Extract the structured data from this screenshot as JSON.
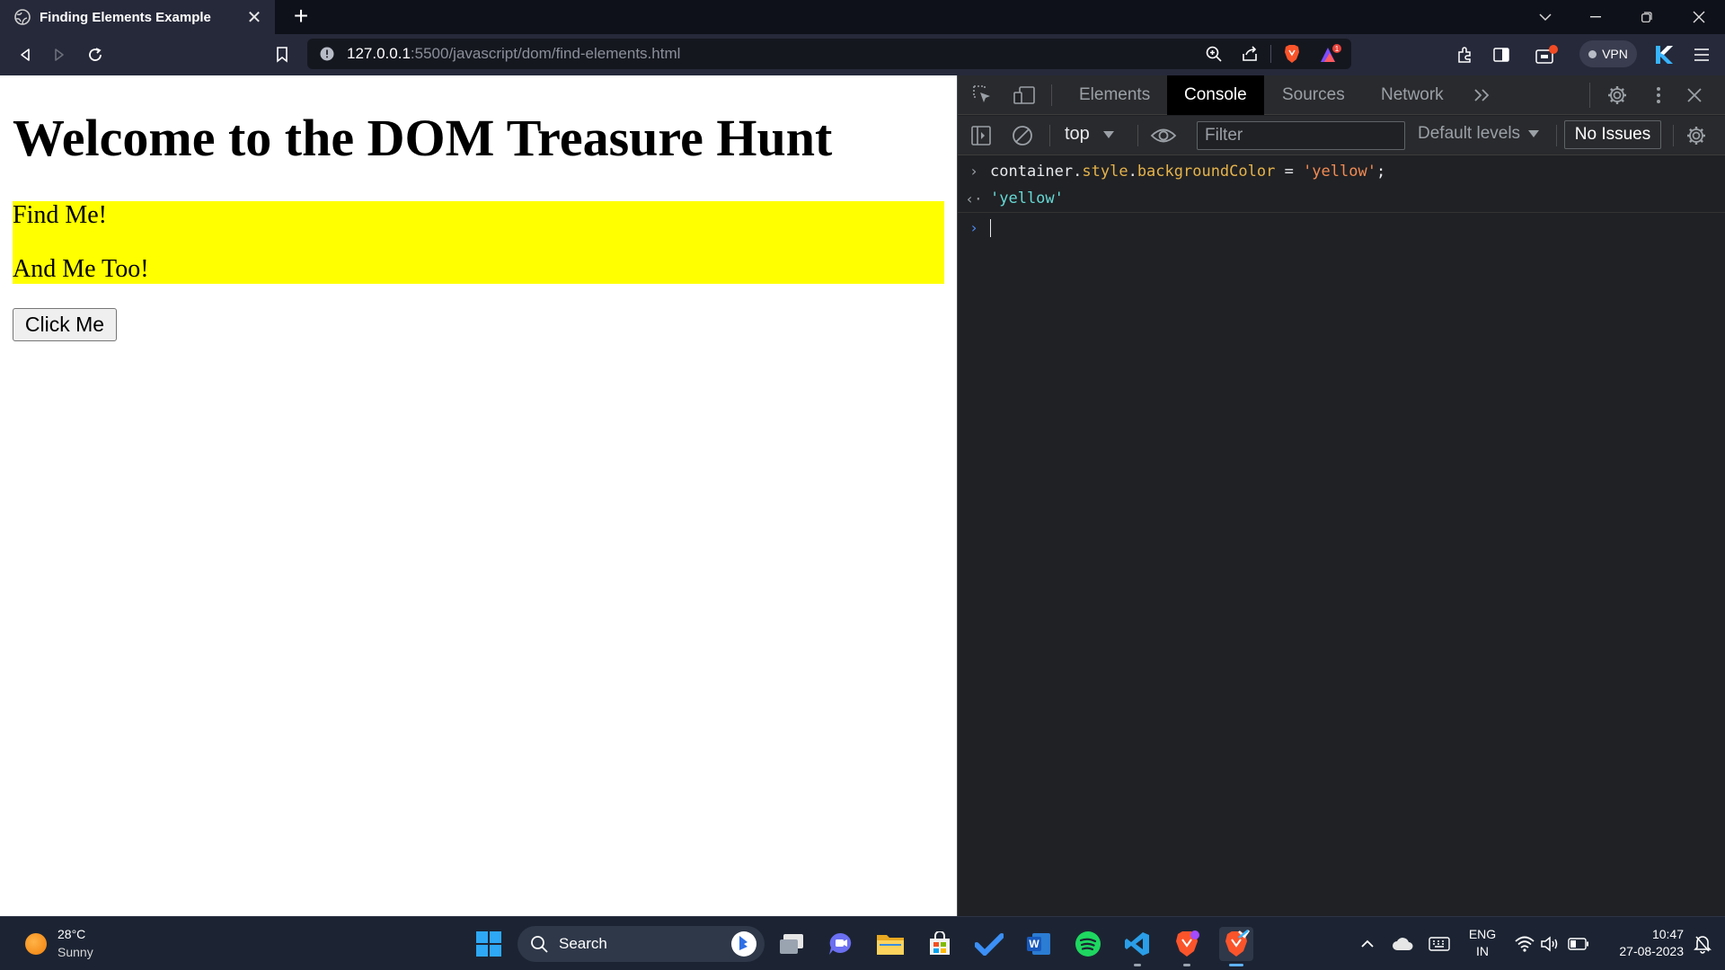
{
  "browser": {
    "tab_title": "Finding Elements Example",
    "url_host": "127.0.0.1",
    "url_rest": ":5500/javascript/dom/find-elements.html",
    "vpn_label": "VPN",
    "brave_badge": "1"
  },
  "page": {
    "heading": "Welcome to the DOM Treasure Hunt",
    "paragraphs": [
      "Find Me!",
      "And Me Too!"
    ],
    "container_bg": "#ffff00",
    "button_label": "Click Me"
  },
  "devtools": {
    "tabs": [
      "Elements",
      "Console",
      "Sources",
      "Network"
    ],
    "active_tab": "Console",
    "context": "top",
    "filter_placeholder": "Filter",
    "levels": "Default levels",
    "issues": "No Issues",
    "console": {
      "input": {
        "obj": "container",
        "dot1": ".",
        "prop1": "style",
        "dot2": ".",
        "prop2": "backgroundColor",
        "op": " = ",
        "str": "'yellow'",
        "end": ";"
      },
      "result": "'yellow'"
    }
  },
  "taskbar": {
    "weather_temp": "28°C",
    "weather_cond": "Sunny",
    "search_label": "Search",
    "lang_top": "ENG",
    "lang_bottom": "IN",
    "time": "10:47",
    "date": "27-08-2023"
  }
}
